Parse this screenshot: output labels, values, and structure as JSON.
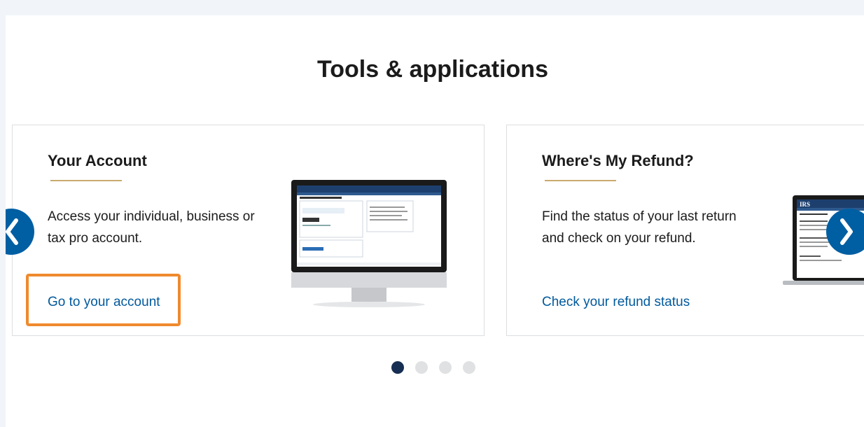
{
  "section": {
    "title": "Tools & applications"
  },
  "cards": [
    {
      "title": "Your Account",
      "description": "Access your individual, business or tax pro account.",
      "link": "Go to your account"
    },
    {
      "title": "Where's My Refund?",
      "description": "Find the status of your last return and check on your refund.",
      "link": "Check your refund status"
    }
  ],
  "carousel": {
    "prev_icon": "chevron-left-icon",
    "next_icon": "chevron-right-icon",
    "page_count": 4,
    "active_page": 1
  },
  "colors": {
    "accent_rule": "#c9a96e",
    "link": "#00599c",
    "focus_ring": "#ef8a2e",
    "arrow_bg": "#005ea2",
    "active_dot": "#162e51"
  }
}
